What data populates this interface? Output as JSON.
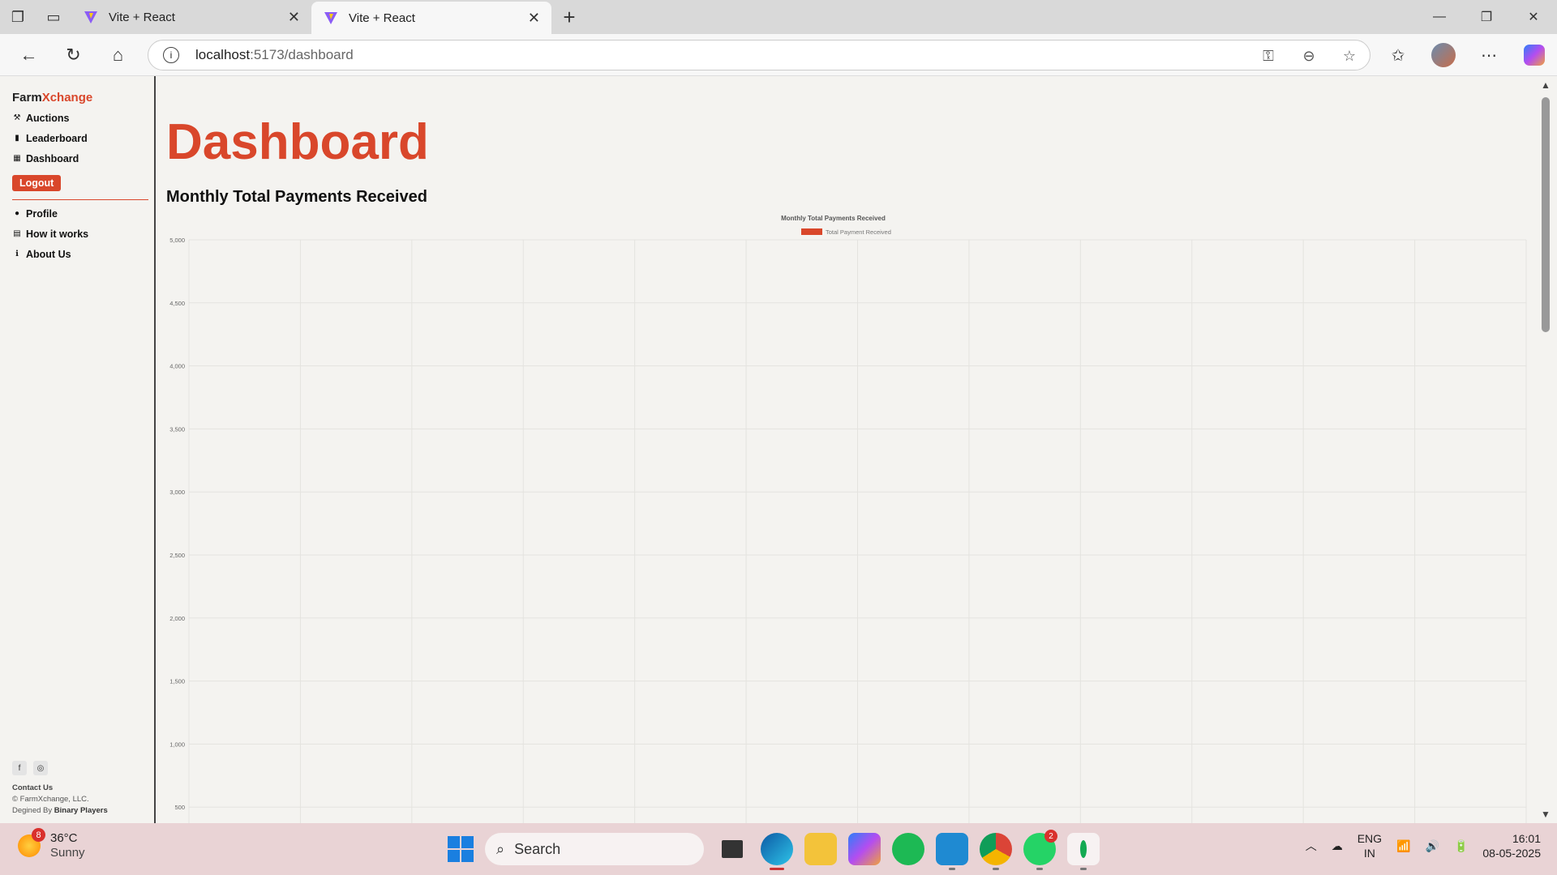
{
  "browser": {
    "tabs": [
      {
        "title": "Vite + React",
        "active": false
      },
      {
        "title": "Vite + React",
        "active": true
      }
    ],
    "url_host": "localhost",
    "url_path": ":5173/dashboard"
  },
  "sidebar": {
    "brand_part1": "Farm",
    "brand_part2": "Xchange",
    "items": [
      {
        "label": "Auctions",
        "icon": "gavel-icon"
      },
      {
        "label": "Leaderboard",
        "icon": "bar-chart-icon"
      },
      {
        "label": "Dashboard",
        "icon": "grid-icon"
      }
    ],
    "logout_label": "Logout",
    "items2": [
      {
        "label": "Profile",
        "icon": "user-circle-icon"
      },
      {
        "label": "How it works",
        "icon": "store-icon"
      },
      {
        "label": "About Us",
        "icon": "info-icon"
      }
    ],
    "footer": {
      "contact": "Contact Us",
      "copyright": "© FarmXchange, LLC.",
      "designed_prefix": "Degined By ",
      "designed_by": "Binary Players"
    }
  },
  "main": {
    "title": "Dashboard",
    "subtitle": "Monthly Total Payments Received"
  },
  "chart_data": {
    "type": "bar",
    "title": "Monthly Total Payments Received",
    "legend": "Total Payment Received",
    "legend_color": "#d9472b",
    "y_ticks": [
      "5,000",
      "4,500",
      "4,000",
      "3,500",
      "3,000",
      "2,500",
      "2,000",
      "1,500",
      "1,000",
      "500"
    ],
    "ylim": [
      500,
      5000
    ],
    "categories": [],
    "values": [],
    "grid": true,
    "x_gridlines": 12
  },
  "taskbar": {
    "weather_temp": "36°C",
    "weather_cond": "Sunny",
    "weather_badge": "8",
    "search_label": "Search",
    "whatsapp_badge": "2",
    "lang_top": "ENG",
    "lang_bottom": "IN",
    "time": "16:01",
    "date": "08-05-2025"
  },
  "colors": {
    "accent": "#d9472b"
  }
}
